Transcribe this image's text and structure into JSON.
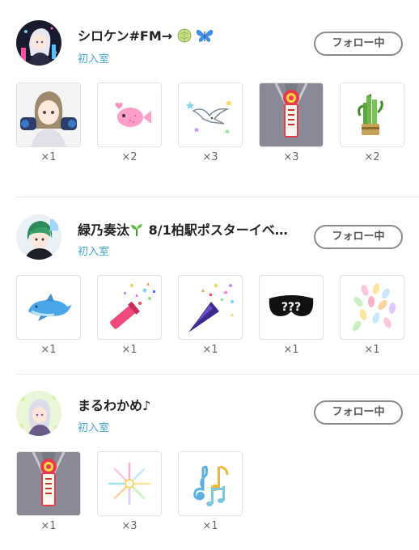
{
  "users": [
    {
      "name": "シロケン#FM→",
      "status": "初入室",
      "follow_label": "フォロー中",
      "gifts": [
        {
          "icon": "character-gift-icon",
          "count": "×1"
        },
        {
          "icon": "pink-fish-icon",
          "count": "×2"
        },
        {
          "icon": "seagull-stars-icon",
          "count": "×3"
        },
        {
          "icon": "rosette-badge-icon",
          "count": "×3"
        },
        {
          "icon": "kadomatsu-icon",
          "count": "×2"
        }
      ]
    },
    {
      "name": "緑乃奏汰",
      "name_suffix": "8/1柏駅ポスターイベ…",
      "status": "初入室",
      "follow_label": "フォロー中",
      "gifts": [
        {
          "icon": "dolphin-icon",
          "count": "×1"
        },
        {
          "icon": "confetti-cannon-icon",
          "count": "×1"
        },
        {
          "icon": "party-popper-icon",
          "count": "×1"
        },
        {
          "icon": "mystery-mask-icon",
          "count": "×1",
          "label": "???"
        },
        {
          "icon": "petals-icon",
          "count": "×1"
        }
      ]
    },
    {
      "name": "まるわかめ♪",
      "status": "初入室",
      "follow_label": "フォロー中",
      "gifts": [
        {
          "icon": "rosette-badge-icon",
          "count": "×1"
        },
        {
          "icon": "fireworks-icon",
          "count": "×3"
        },
        {
          "icon": "music-notes-icon",
          "count": "×1"
        }
      ]
    }
  ],
  "colors": {
    "status_blue": "#3fa9d8",
    "button_border": "#8a8a8a",
    "divider": "#e6e6e6"
  }
}
